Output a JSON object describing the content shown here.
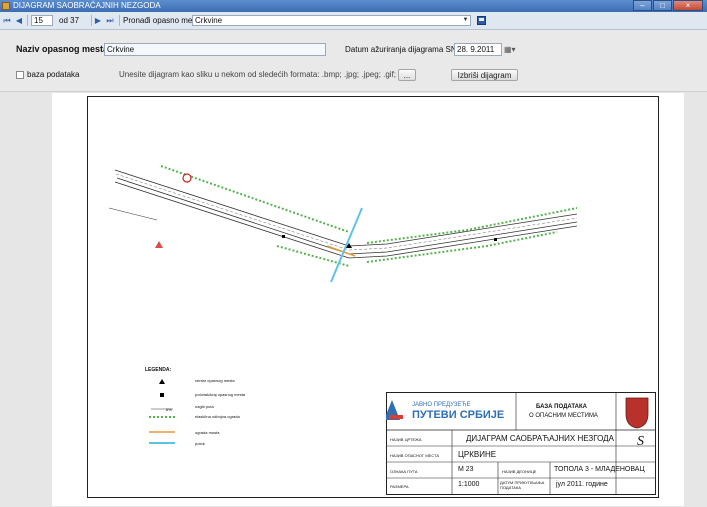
{
  "window": {
    "title": "DIJAGRAM SAOBRAĆAJNIH NEZGODA"
  },
  "navigator": {
    "current": "15",
    "of_total": "od 37",
    "search_label": "Pronađi opasno mesto:",
    "search_value": "Crkvine"
  },
  "form": {
    "place_label": "Naziv opasnog mesta:",
    "place_value": "Crkvine",
    "date_label": "Datum ažuriranja dijagrama SN:",
    "date_value": "28. 9.2011",
    "db_label": "baza podataka",
    "instruction": "Unesite dijagram kao sliku u nekom od sledećih formata: .bmp; .jpg; .jpeg; .gif; .png",
    "browse_label": "...",
    "delete_label": "Izbriši dijagram"
  },
  "legend": {
    "title": "LEGENDA:",
    "items": [
      "centar opasnog mesta",
      "početak/kraj opasnog mesta",
      "nagib puta",
      "elastična odbojna ograda",
      "ograda mosta",
      "potok"
    ],
    "slope_value": "6%"
  },
  "title_block": {
    "company_small": "ЈАВНО ПРЕДУЗЕЋЕ",
    "company_big": "ПУТЕВИ СРБИЈЕ",
    "db_line1": "БАЗА ПОДАТАКА",
    "db_line2": "О ОПАСНИМ МЕСТИМА",
    "row1_label": "НАЗИВ ЦРТЕЖА",
    "row1_value": "ДИЈАГРАМ САОБРАЋАЈНИХ НЕЗГОДА",
    "row2_label": "НАЗИВ ОПАСНОГ МЕСТА",
    "row2_value": "ЦРКВИНЕ",
    "row3_label": "ОЗНАКА ПУТА",
    "row3_value": "М 23",
    "row3_label2": "НАЗИВ ДЕОНИЦЕ",
    "row3_value2": "ТОПОЛА 3 - МЛАДЕНОВАЦ",
    "row4_label": "РАЗМЕРА",
    "row4_value": "1:1000",
    "row4_label2": "ДАТУМ ПРИКУПЉАЊА ПОДАТАКА",
    "row4_value2": "јул 2011. године",
    "signature": "S"
  },
  "colors": {
    "guardrail": "#55b24c",
    "bridge_fence": "#e39b3a",
    "stream": "#5bc4e6",
    "road_line": "#333333"
  },
  "icons": [
    "first-record-icon",
    "prev-record-icon",
    "next-record-icon",
    "last-record-icon",
    "save-icon",
    "calendar-icon"
  ]
}
